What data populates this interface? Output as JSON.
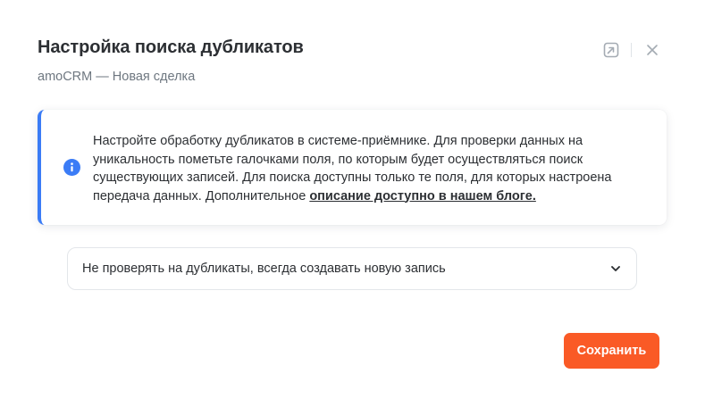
{
  "modal": {
    "title": "Настройка поиска дубликатов",
    "subtitle": "amoCRM — Новая сделка"
  },
  "header_actions": {
    "open_icon": "open-external-icon",
    "close_icon": "close-icon"
  },
  "info": {
    "icon": "info-icon",
    "text": "Настройте обработку дубликатов в системе-приёмнике. Для проверки данных на уникальность пометьте галочками поля, по которым будет осуществляться поиск существующих записей. Для поиска доступны только те поля, для которых настроена передача данных. Дополнительное ",
    "link_text": "описание доступно в нашем блоге.",
    "accent_color": "#3b7cf6"
  },
  "duplicate_select": {
    "value": "Не проверять на дубликаты, всегда создавать новую запись",
    "icon": "chevron-down-icon"
  },
  "footer": {
    "save_label": "Сохранить",
    "save_color": "#fa5a26"
  }
}
